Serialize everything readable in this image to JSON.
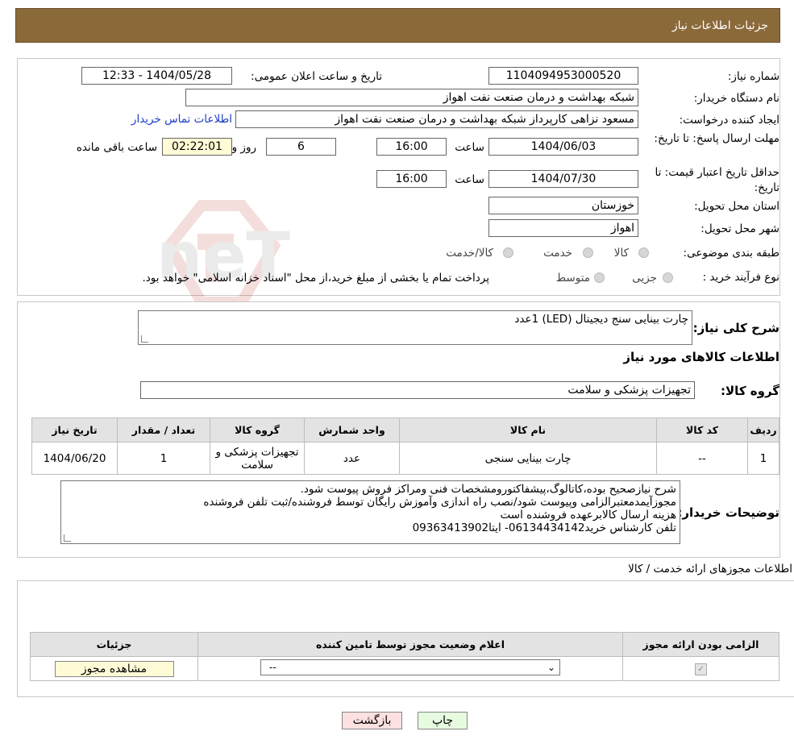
{
  "header": {
    "title": "جزئیات اطلاعات نیاز"
  },
  "form": {
    "need_number_label": "شماره نیاز:",
    "need_number": "1104094953000520",
    "announce_label": "تاریخ و ساعت اعلان عمومی:",
    "announce_value": "1404/05/28 - 12:33",
    "buyer_label": "نام دستگاه خریدار:",
    "buyer_value": "شبکه بهداشت و درمان صنعت نفت اهواز",
    "creator_label": "ایجاد کننده درخواست:",
    "creator_value": "مسعود نزاهی کارپرداز شبکه بهداشت و درمان صنعت نفت اهواز",
    "contact_link": "اطلاعات تماس خریدار",
    "deadline_label": "مهلت ارسال پاسخ: تا تاریخ:",
    "deadline_date": "1404/06/03",
    "time_label": "ساعت",
    "deadline_time": "16:00",
    "days_value": "6",
    "days_label": "روز و",
    "remaining_value": "02:22:01",
    "remaining_label": "ساعت باقی مانده",
    "validity_label": "حداقل تاریخ اعتبار قیمت: تا تاریخ:",
    "validity_date": "1404/07/30",
    "validity_time": "16:00",
    "province_label": "استان محل تحویل:",
    "province_value": "خوزستان",
    "city_label": "شهر محل تحویل:",
    "city_value": "اهواز",
    "category_label": "طبقه بندی موضوعی:",
    "category_options": [
      "کالا",
      "خدمت",
      "کالا/خدمت"
    ],
    "process_label": "نوع فرآیند خرید :",
    "process_options": [
      "جزیی",
      "متوسط"
    ],
    "process_note": "پرداخت تمام یا بخشی از مبلغ خرید،از محل \"اسناد خزانه اسلامی\" خواهد بود."
  },
  "summary": {
    "label": "شرح کلی نیاز:",
    "value": "چارت بینایی سنج دیجیتال (LED)    1عدد",
    "goods_info_title": "اطلاعات کالاهای مورد نیاز",
    "group_label": "گروه کالا:",
    "group_value": "تجهیزات پزشکی و سلامت"
  },
  "goods_table": {
    "headers": [
      "ردیف",
      "کد کالا",
      "نام کالا",
      "واحد شمارش",
      "گروه کالا",
      "تعداد / مقدار",
      "تاریخ نیاز"
    ],
    "rows": [
      [
        "1",
        "--",
        "چارت بینایی سنجی",
        "عدد",
        "تجهیزات پزشکی و سلامت",
        "1",
        "1404/06/20"
      ]
    ]
  },
  "buyer_notes": {
    "label": "توضیحات خریدار:",
    "lines": [
      "شرح نیازصحیح بوده،کاتالوگ،پیشفاکتورومشخصات فنی ومراکز فروش پیوست شود.",
      "مجوزآیمدمعتبرالزامی وپیوست شود/نصب راه اندازی وآموزش رایگان توسط فروشنده/ثبت تلفن فروشنده",
      "هزینه ارسال کالابرعهده فروشنده است",
      "تلفن کارشناس خرید06134434142- ایتا09363413902"
    ]
  },
  "permits": {
    "title": "اطلاعات مجوزهای ارائه خدمت / کالا",
    "headers": [
      "الزامی بودن ارائه مجوز",
      "اعلام وضعیت مجوز توسط تامین کننده",
      "جزئیات"
    ],
    "select_value": "--",
    "view_button": "مشاهده مجوز"
  },
  "actions": {
    "print": "چاپ",
    "back": "بازگشت"
  },
  "colors": {
    "header_bg": "#8b6a3a",
    "link": "#1a3cc8",
    "remaining_bg": "#fffbd6",
    "back_bg": "#fde0e0",
    "print_bg": "#e6fbe0"
  }
}
